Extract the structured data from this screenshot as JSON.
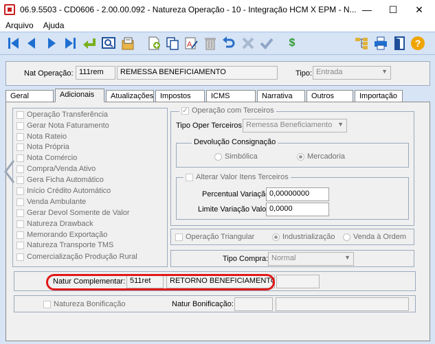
{
  "window": {
    "title": "06.9.5503 - CD0606 - 2.00.00.092 - Natureza Operação - 10 - Integração HCM X EPM - N...",
    "minimize_glyph": "—",
    "maximize_glyph": "☐",
    "close_glyph": "✕"
  },
  "menu": {
    "items": [
      "Arquivo",
      "Ajuda"
    ]
  },
  "toolbar": {
    "icons": [
      "first-record",
      "previous-record",
      "next-record",
      "last-record",
      "enter",
      "query",
      "export",
      "new-document",
      "copy",
      "edit-text",
      "trash",
      "undo",
      "cancel",
      "confirm",
      "currency",
      "tree",
      "print",
      "exit",
      "help"
    ],
    "currency_glyph": "$",
    "help_glyph": "?"
  },
  "header": {
    "nat_operacao_label": "Nat Operação:",
    "nat_operacao_code": "111rem",
    "nat_operacao_desc": "REMESSA BENEFICIAMENTO",
    "tipo_label": "Tipo:",
    "tipo_value": "Entrada"
  },
  "tabs": [
    "Geral",
    "Adicionais",
    "Atualizações",
    "Impostos",
    "ICMS",
    "Narrativa",
    "Outros",
    "Importação"
  ],
  "active_tab": "Adicionais",
  "left_checkboxes": [
    "Operação Transferência",
    "Gerar Nota Faturamento",
    "Nota Rateio",
    "Nota Própria",
    "Nota Comércio",
    "Compra/Venda Ativo",
    "Gera Ficha Automático",
    "Início Crédito Automático",
    "Venda Ambulante",
    "Gerar Devol Somente de Valor",
    "Natureza Drawback",
    "Memorando Exportação",
    "Natureza Transporte TMS",
    "Comercialização Produção Rural"
  ],
  "terceiros": {
    "operacao_label": "Operação com Terceiros",
    "operacao_checked": true,
    "tipo_oper_label": "Tipo Oper Terceiros:",
    "tipo_oper_value": "Remessa Beneficiamento",
    "devolucao_legend": "Devolução Consignação",
    "simbolica_label": "Simbólica",
    "mercadoria_label": "Mercadoria",
    "alterar_label": "Alterar Valor Itens Terceiros",
    "percentual_label": "Percentual Variação:",
    "percentual_value": "0,00000000",
    "limite_label": "Limite Variação Valor:",
    "limite_value": "0,0000"
  },
  "triangular": {
    "operacao_label": "Operação Triangular",
    "industrializacao_label": "Industrialização",
    "venda_ordem_label": "Venda à Ordem"
  },
  "compra": {
    "tipo_label": "Tipo Compra:",
    "tipo_value": "Normal"
  },
  "complementar": {
    "label": "Natur Complementar:",
    "code": "511ret",
    "desc": "RETORNO BENEFICIAMENTO"
  },
  "bonificacao": {
    "checkbox_label": "Natureza Bonificação",
    "label": "Natur Bonificação:"
  }
}
